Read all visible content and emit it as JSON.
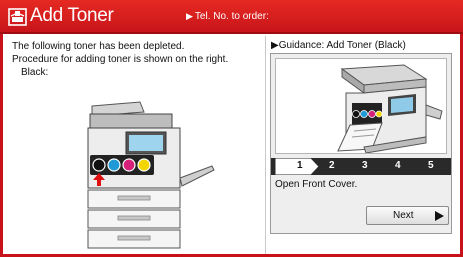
{
  "header": {
    "title": "Add Toner",
    "tel_label": "Tel. No. to order:",
    "icon": "toner-icon",
    "accent_color": "#d81e1e"
  },
  "message": {
    "line1": "The following toner has been depleted.",
    "line2": "Procedure for adding toner is shown on the right.",
    "line3": "Black:"
  },
  "guidance": {
    "title": "Guidance: Add Toner (Black)",
    "steps": [
      "1",
      "2",
      "3",
      "4",
      "5"
    ],
    "current_step": "1",
    "step_text": "Open Front Cover.",
    "next_label": "Next"
  },
  "toner_colors": [
    "#111111",
    "#1f9ad6",
    "#d6207a",
    "#f2d600"
  ]
}
